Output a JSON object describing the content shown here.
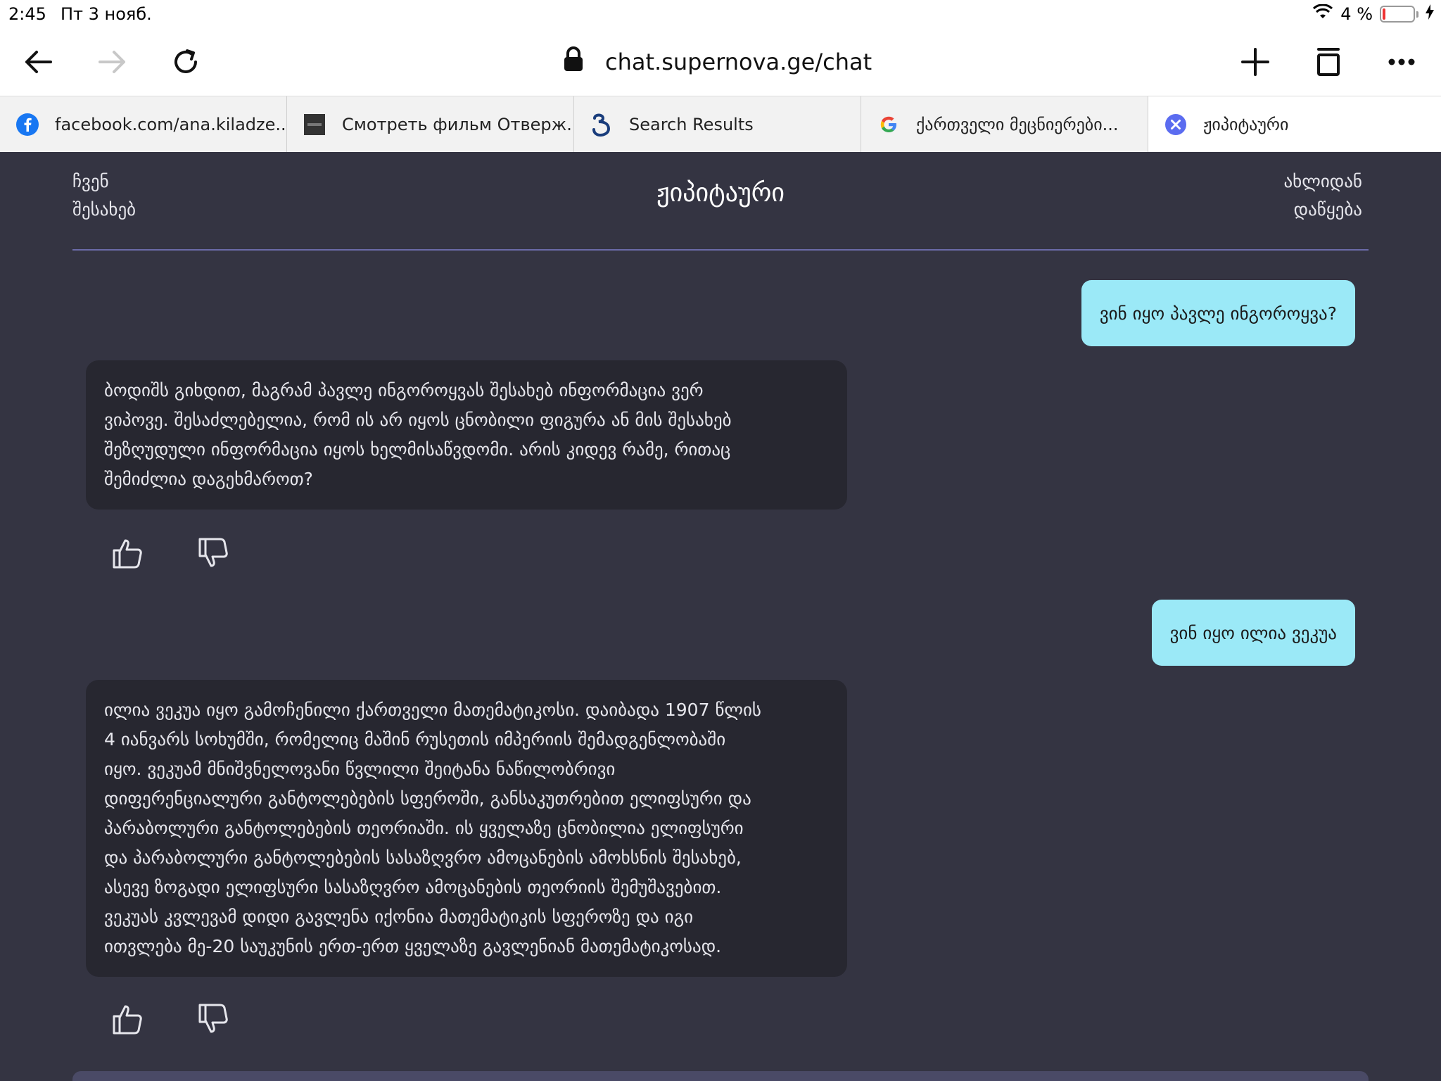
{
  "status": {
    "time": "2:45",
    "date": "Пт 3 нояб.",
    "battery": "4 %",
    "battery_level": 0.04
  },
  "toolbar": {
    "url": "chat.supernova.ge/chat",
    "icons": [
      "back-arrow-icon",
      "forward-arrow-icon",
      "reload-icon",
      "lock-icon",
      "plus-icon",
      "tabs-icon",
      "more-icon"
    ]
  },
  "tabs": [
    {
      "label": "facebook.com/ana.kiladze...",
      "icon": "facebook-icon",
      "color": "#1877f2"
    },
    {
      "label": "Смотреть фильм Отверж...",
      "icon": "film-site-icon",
      "color": "#333333"
    },
    {
      "label": "Search Results",
      "icon": "georgian-letter-icon",
      "color": "#1a3d7c"
    },
    {
      "label": "ქართველი მეცნიერები...",
      "icon": "google-icon",
      "color": "#4285f4"
    },
    {
      "label": "ჟიპიტაური",
      "icon": "close-circle-icon",
      "color": "#5b6cf0",
      "active": true
    }
  ],
  "app": {
    "nav_left_line1": "ჩვენ",
    "nav_left_line2": "შესახებ",
    "title": "ჟიპიტაური",
    "nav_right_line1": "ახლიდან",
    "nav_right_line2": "დაწყება",
    "colors": {
      "background": "#343442",
      "user_bubble": "#9be9f7",
      "bot_bubble": "#272730",
      "divider": "#6b6ba8"
    }
  },
  "messages": [
    {
      "role": "user",
      "text": "ვინ იყო პავლე ინგოროყვა?"
    },
    {
      "role": "bot",
      "lines": [
        "ბოდიშს გიხდით, მაგრამ პავლე ინგოროყვას შესახებ ინფორმაცია ვერ",
        "ვიპოვე. შესაძლებელია, რომ ის არ იყოს ცნობილი ფიგურა ან მის შესახებ",
        "შეზღუდული ინფორმაცია იყოს ხელმისაწვდომი. არის კიდევ რამე, რითაც",
        "შემიძლია დაგეხმაროთ?"
      ]
    },
    {
      "role": "user",
      "text": "ვინ იყო ილია ვეკუა"
    },
    {
      "role": "bot",
      "lines": [
        "ილია ვეკუა იყო გამოჩენილი ქართველი მათემატიკოსი. დაიბადა 1907 წლის",
        "4 იანვარს სოხუმში, რომელიც მაშინ რუსეთის იმპერიის შემადგენლობაში",
        "იყო. ვეკუამ მნიშვნელოვანი წვლილი შეიტანა ნაწილობრივი",
        "დიფერენციალური განტოლებების სფეროში, განსაკუთრებით ელიფსური და",
        "პარაბოლური განტოლებების თეორიაში. ის ყველაზე ცნობილია ელიფსური",
        "და პარაბოლური განტოლებების სასაზღვრო ამოცანების ამოხსნის შესახებ,",
        "ასევე ზოგადი ელიფსური სასაზღვრო ამოცანების თეორიის შემუშავებით.",
        "ვეკუას კვლევამ დიდი გავლენა იქონია მათემატიკის სფეროზე და იგი",
        "ითვლება მე-20 საუკუნის ერთ-ერთ ყველაზე გავლენიან მათემატიკოსად."
      ]
    }
  ]
}
